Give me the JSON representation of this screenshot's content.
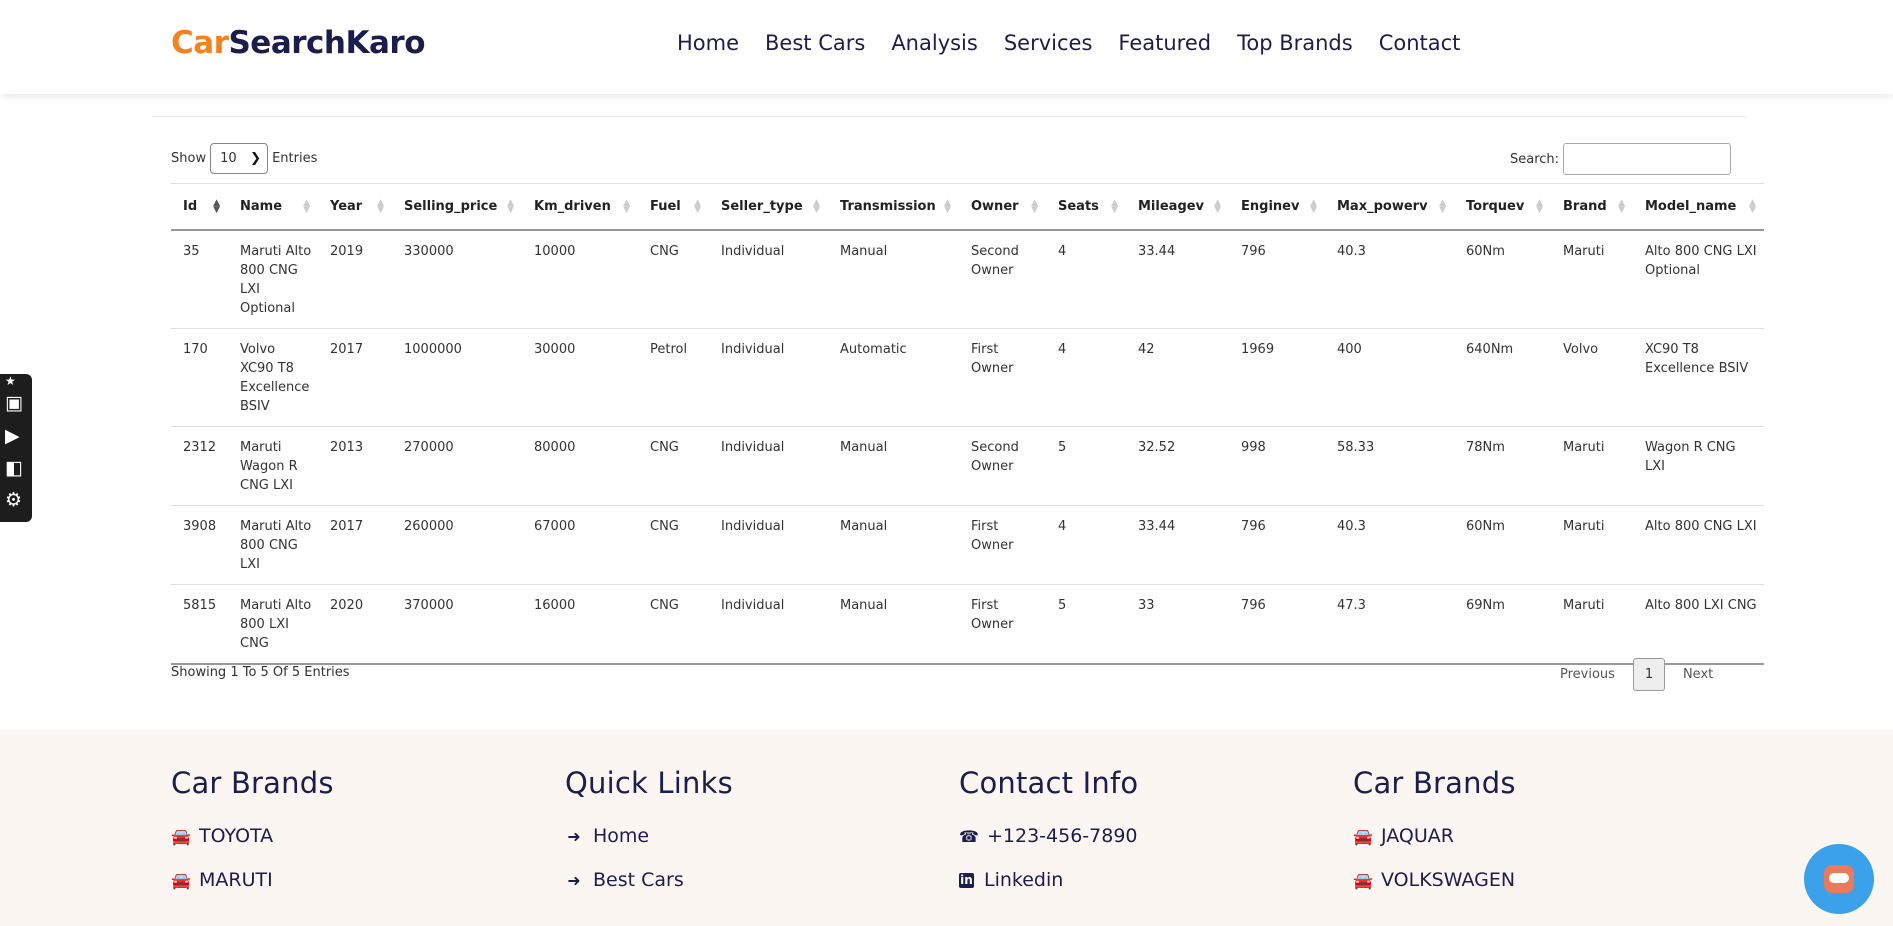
{
  "header": {
    "logo_part1": "Car",
    "logo_part2": "SearchKaro",
    "nav": [
      "Home",
      "Best Cars",
      "Analysis",
      "Services",
      "Featured",
      "Top Brands",
      "Contact"
    ]
  },
  "table_controls": {
    "show_label": "Show",
    "entries_value": "10",
    "entries_label": "Entries",
    "search_label": "Search:",
    "search_value": ""
  },
  "table": {
    "columns": [
      "Id",
      "Name",
      "Year",
      "Selling_price",
      "Km_driven",
      "Fuel",
      "Seller_type",
      "Transmission",
      "Owner",
      "Seats",
      "Mileagev",
      "Enginev",
      "Max_powerv",
      "Torquev",
      "Brand",
      "Model_name"
    ],
    "rows": [
      [
        "35",
        "Maruti Alto 800 CNG LXI Optional",
        "2019",
        "330000",
        "10000",
        "CNG",
        "Individual",
        "Manual",
        "Second Owner",
        "4",
        "33.44",
        "796",
        "40.3",
        "60Nm",
        "Maruti",
        "Alto 800 CNG LXI Optional"
      ],
      [
        "170",
        "Volvo XC90 T8 Excellence BSIV",
        "2017",
        "1000000",
        "30000",
        "Petrol",
        "Individual",
        "Automatic",
        "First Owner",
        "4",
        "42",
        "1969",
        "400",
        "640Nm",
        "Volvo",
        "XC90 T8 Excellence BSIV"
      ],
      [
        "2312",
        "Maruti Wagon R CNG LXI",
        "2013",
        "270000",
        "80000",
        "CNG",
        "Individual",
        "Manual",
        "Second Owner",
        "5",
        "32.52",
        "998",
        "58.33",
        "78Nm",
        "Maruti",
        "Wagon R CNG LXI"
      ],
      [
        "3908",
        "Maruti Alto 800 CNG LXI",
        "2017",
        "260000",
        "67000",
        "CNG",
        "Individual",
        "Manual",
        "First Owner",
        "4",
        "33.44",
        "796",
        "40.3",
        "60Nm",
        "Maruti",
        "Alto 800 CNG LXI"
      ],
      [
        "5815",
        "Maruti Alto 800 LXI CNG",
        "2020",
        "370000",
        "16000",
        "CNG",
        "Individual",
        "Manual",
        "First Owner",
        "5",
        "33",
        "796",
        "47.3",
        "69Nm",
        "Maruti",
        "Alto 800 LXI CNG"
      ]
    ]
  },
  "table_footer": {
    "info": "Showing 1 To 5 Of 5 Entries",
    "previous": "Previous",
    "page": "1",
    "next": "Next"
  },
  "footer": {
    "col1": {
      "title": "Car Brands",
      "items": [
        "TOYOTA",
        "MARUTI"
      ],
      "icon": "car-icon"
    },
    "col2": {
      "title": "Quick Links",
      "items": [
        "Home",
        "Best Cars"
      ],
      "icon": "arrow-right-icon"
    },
    "col3": {
      "title": "Contact Info",
      "items": [
        "+123-456-7890",
        "Linkedin"
      ],
      "icons": [
        "phone-icon",
        "linkedin-icon"
      ]
    },
    "col4": {
      "title": "Car Brands",
      "items": [
        "JAQUAR",
        "VOLKSWAGEN"
      ],
      "icon": "car-icon"
    }
  },
  "colors": {
    "accent": "#f5821f",
    "brand": "#1b1d4d",
    "footer_bg": "#fcf6f2",
    "chat": "#3ba1ea"
  }
}
